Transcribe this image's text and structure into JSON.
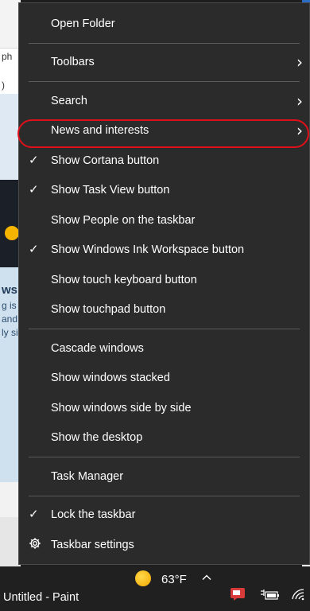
{
  "background": {
    "fragment_ph": "ph",
    "fragment_paren": ")",
    "fragment_heading": "ws w",
    "fragment_lines": [
      "g is",
      "and",
      "ly si"
    ]
  },
  "menu": {
    "items": [
      {
        "label": "Open Folder"
      },
      {
        "label": "Toolbars",
        "submenu": true
      },
      {
        "label": "Search",
        "submenu": true
      },
      {
        "label": "News and interests",
        "submenu": true,
        "highlighted": true
      },
      {
        "label": "Show Cortana button",
        "checked": true
      },
      {
        "label": "Show Task View button",
        "checked": true
      },
      {
        "label": "Show People on the taskbar"
      },
      {
        "label": "Show Windows Ink Workspace button",
        "checked": true
      },
      {
        "label": "Show touch keyboard button"
      },
      {
        "label": "Show touchpad button"
      },
      {
        "label": "Cascade windows"
      },
      {
        "label": "Show windows stacked"
      },
      {
        "label": "Show windows side by side"
      },
      {
        "label": "Show the desktop"
      },
      {
        "label": "Task Manager"
      },
      {
        "label": "Lock the taskbar",
        "checked": true
      },
      {
        "label": "Taskbar settings",
        "icon": "gear-icon"
      }
    ],
    "check_glyph": "✓",
    "chevron_glyph": "›",
    "highlight_color": "#e0101a"
  },
  "taskbar": {
    "app_title": "Untitled - Paint",
    "weather_temp": "63°F",
    "weather_icon": "sun-icon"
  }
}
